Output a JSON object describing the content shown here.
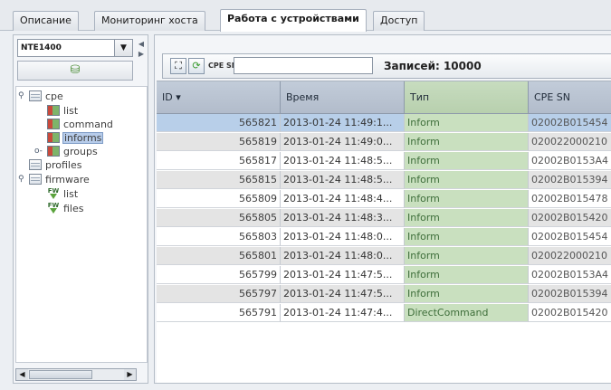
{
  "tabs": [
    {
      "label": "Описание",
      "active": false
    },
    {
      "label": "Мониторинг хоста",
      "active": false
    },
    {
      "label": "Работа с устройствами",
      "active": true
    },
    {
      "label": "Доступ",
      "active": false
    }
  ],
  "device_select": {
    "value": "NTE1400"
  },
  "tree": {
    "cpe": "cpe",
    "list": "list",
    "command": "command",
    "informs": "informs",
    "groups": "groups",
    "profiles": "profiles",
    "firmware": "firmware",
    "fw_list": "list",
    "files": "files",
    "selected": "informs"
  },
  "toolbar": {
    "sn_label": "CPE SN:",
    "sn_value": "",
    "records": "Записей: 10000"
  },
  "table": {
    "columns": [
      "ID ▾",
      "Время",
      "Тип",
      "CPE SN"
    ],
    "rows": [
      {
        "id": "565821",
        "time": "2013-01-24 11:49:1...",
        "type": "Inform",
        "sn": "02002B015454"
      },
      {
        "id": "565819",
        "time": "2013-01-24 11:49:0...",
        "type": "Inform",
        "sn": "020022000210"
      },
      {
        "id": "565817",
        "time": "2013-01-24 11:48:5...",
        "type": "Inform",
        "sn": "02002B0153A4"
      },
      {
        "id": "565815",
        "time": "2013-01-24 11:48:5...",
        "type": "Inform",
        "sn": "02002B015394"
      },
      {
        "id": "565809",
        "time": "2013-01-24 11:48:4...",
        "type": "Inform",
        "sn": "02002B015478"
      },
      {
        "id": "565805",
        "time": "2013-01-24 11:48:3...",
        "type": "Inform",
        "sn": "02002B015420"
      },
      {
        "id": "565803",
        "time": "2013-01-24 11:48:0...",
        "type": "Inform",
        "sn": "02002B015454"
      },
      {
        "id": "565801",
        "time": "2013-01-24 11:48:0...",
        "type": "Inform",
        "sn": "020022000210"
      },
      {
        "id": "565799",
        "time": "2013-01-24 11:47:5...",
        "type": "Inform",
        "sn": "02002B0153A4"
      },
      {
        "id": "565797",
        "time": "2013-01-24 11:47:5...",
        "type": "Inform",
        "sn": "02002B015394"
      },
      {
        "id": "565791",
        "time": "2013-01-24 11:47:4...",
        "type": "DirectCommand",
        "sn": "02002B015420"
      }
    ]
  }
}
